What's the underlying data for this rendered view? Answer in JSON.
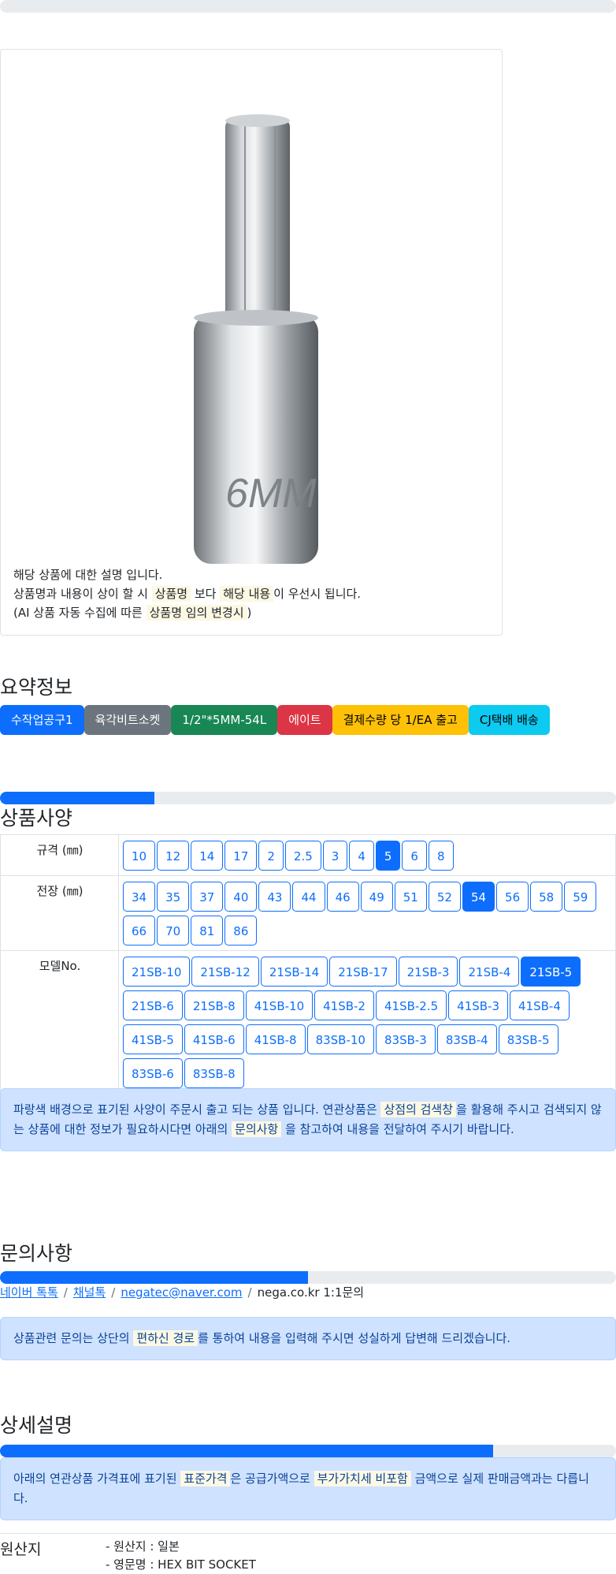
{
  "product": {
    "description_lines": [
      "해당 상품에 대한 설명 입니다.",
      "상품명과 내용이 상이 할 시 ",
      "상품명",
      " 보다 ",
      "해당 내용",
      "이 우선시 됩니다.",
      "(AI 상품 자동 수집에 따른 ",
      "상품명 임의 변경시",
      ")"
    ],
    "image_label": "6MM"
  },
  "summary": {
    "title": "요약정보",
    "badges": [
      {
        "label": "수작업공구1",
        "color": "#0d6efd",
        "text_color": "#ffffff"
      },
      {
        "label": "육각비트소켓",
        "color": "#6c757d",
        "text_color": "#ffffff"
      },
      {
        "label": "1/2\"*5MM-54L",
        "color": "#198754",
        "text_color": "#ffffff"
      },
      {
        "label": "에이트",
        "color": "#dc3545",
        "text_color": "#ffffff"
      },
      {
        "label": "결제수량 당 1/EA 출고",
        "color": "#ffc107",
        "text_color": "#000000"
      },
      {
        "label": "CJ택배 배송",
        "color": "#0dcaf0",
        "text_color": "#000000"
      }
    ]
  },
  "spec": {
    "title": "상품사양",
    "progress": 0.25,
    "rows": [
      {
        "label": "규격 (㎜)",
        "options": [
          "10",
          "12",
          "14",
          "17",
          "2",
          "2.5",
          "3",
          "4",
          "5",
          "6",
          "8"
        ],
        "selected": "5"
      },
      {
        "label": "전장 (㎜)",
        "options": [
          "34",
          "35",
          "37",
          "40",
          "43",
          "44",
          "46",
          "49",
          "51",
          "52",
          "54",
          "56",
          "58",
          "59",
          "66",
          "70",
          "81",
          "86"
        ],
        "selected": "54"
      },
      {
        "label": "모델No.",
        "options": [
          "21SB-10",
          "21SB-12",
          "21SB-14",
          "21SB-17",
          "21SB-3",
          "21SB-4",
          "21SB-5",
          "21SB-6",
          "21SB-8",
          "41SB-10",
          "41SB-2",
          "41SB-2.5",
          "41SB-3",
          "41SB-4",
          "41SB-5",
          "41SB-6",
          "41SB-8",
          "83SB-10",
          "83SB-3",
          "83SB-4",
          "83SB-5",
          "83SB-6",
          "83SB-8"
        ],
        "selected": "21SB-5"
      }
    ],
    "note": {
      "a": "파랑색 배경으로 표기된 사양이 주문시 출고 되는 상품 입니다. 연관상품은 ",
      "b": "상점의 검색창",
      "c": "을 활용해 주시고 검색되지 않는 상품에 대한 정보가 필요하시다면 아래의 ",
      "d": "문의사항",
      "e": " 을 참고하여 내용을 전달하여 주시기 바랍니다."
    }
  },
  "inquiry": {
    "title": "문의사항",
    "progress": 0.5,
    "links": [
      "네이버 톡톡",
      "채널톡",
      "negatec@naver.com"
    ],
    "plain": "nega.co.kr 1:1문의",
    "separator": "/",
    "note": {
      "a": "상품관련 문의는 상단의 ",
      "b": "편하신 경로",
      "c": "를 통하여 내용을 입력해 주시면 성실하게 답변해 드리겠습니다."
    }
  },
  "detail": {
    "title": "상세설명",
    "progress": 0.8,
    "note": {
      "a": "아래의 연관상품 가격표에 표기된 ",
      "b": "표준가격",
      "c": "은 공급가액으로 ",
      "d": "부가가치세 비포함",
      "e": " 금액으로 실제 판매금액과는 다릅니다."
    }
  },
  "origin": {
    "label": "원산지",
    "values": [
      "- 원산지 : 일본",
      "- 영문명 : HEX BIT SOCKET"
    ]
  },
  "top_progress": 0.0
}
